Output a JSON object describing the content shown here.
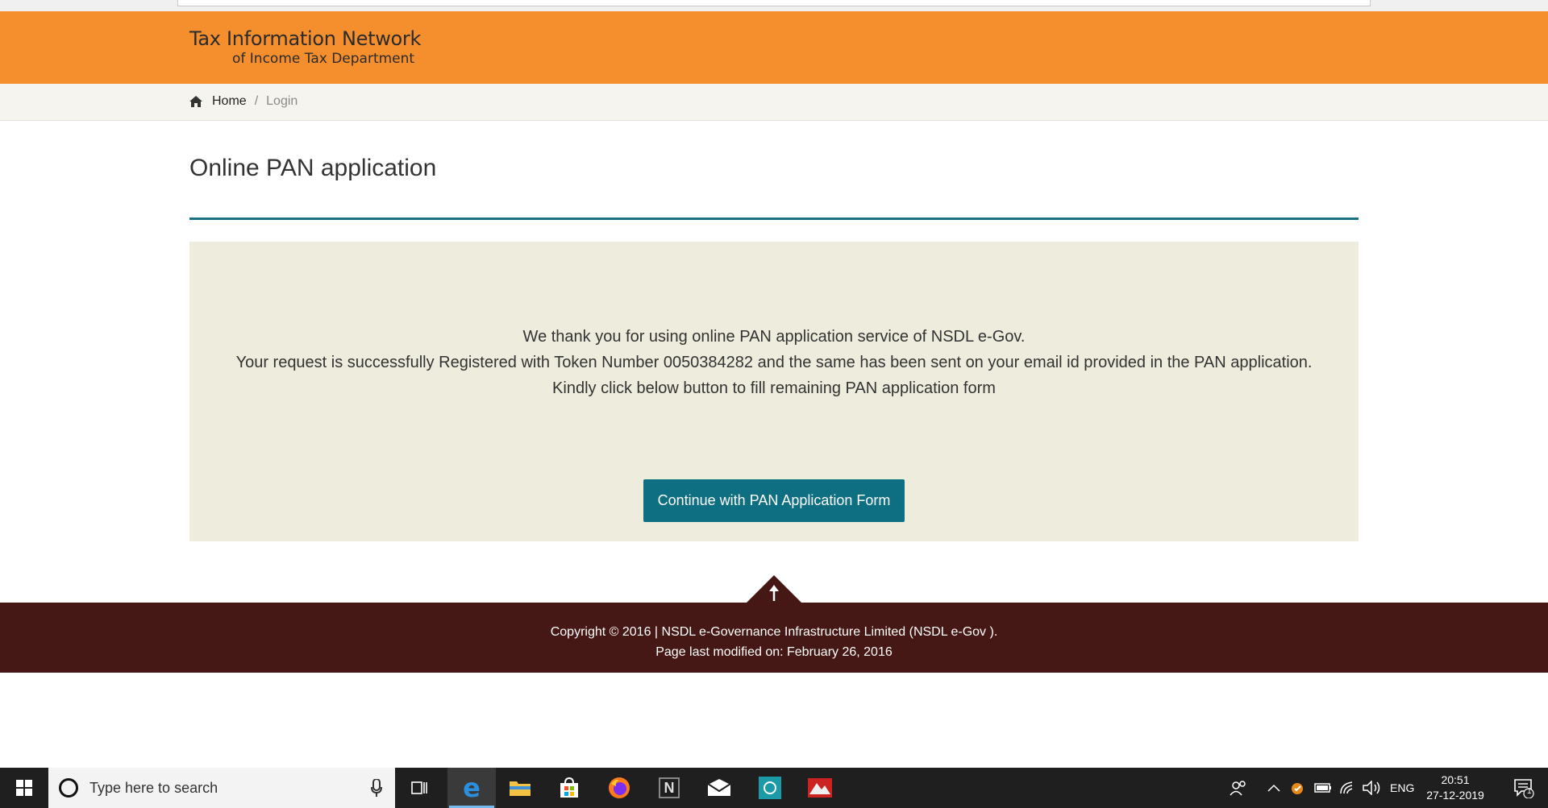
{
  "header": {
    "logo_line1": "Tax Information Network",
    "logo_line2": "of Income Tax Department"
  },
  "breadcrumb": {
    "home": "Home",
    "separator": "/",
    "current": "Login"
  },
  "main": {
    "title": "Online PAN application",
    "message_lines": [
      "We thank you for using online PAN application service of NSDL e-Gov.",
      "Your request is successfully Registered with Token Number 0050384282 and the same has been sent on your email id provided in the PAN application.",
      "Kindly click below button to fill remaining PAN application form"
    ],
    "continue_button": "Continue with PAN Application Form"
  },
  "footer": {
    "copyright": "Copyright © 2016 | NSDL e-Governance Infrastructure Limited (NSDL e-Gov ).",
    "modified": "Page last modified on: February 26, 2016"
  },
  "taskbar": {
    "search_placeholder": "Type here to search",
    "language": "ENG",
    "time": "20:51",
    "date": "27-12-2019",
    "notification_count": "1",
    "pinned_apps": [
      "task-view-icon",
      "edge-icon",
      "file-explorer-icon",
      "store-icon",
      "firefox-icon",
      "notion-icon",
      "mail-icon",
      "whatsapp-icon",
      "app-icon"
    ]
  },
  "colors": {
    "header_orange": "#f58f2e",
    "accent_teal": "#0f6f82",
    "panel_bg": "#eeecdc",
    "footer_brown": "#461815"
  }
}
